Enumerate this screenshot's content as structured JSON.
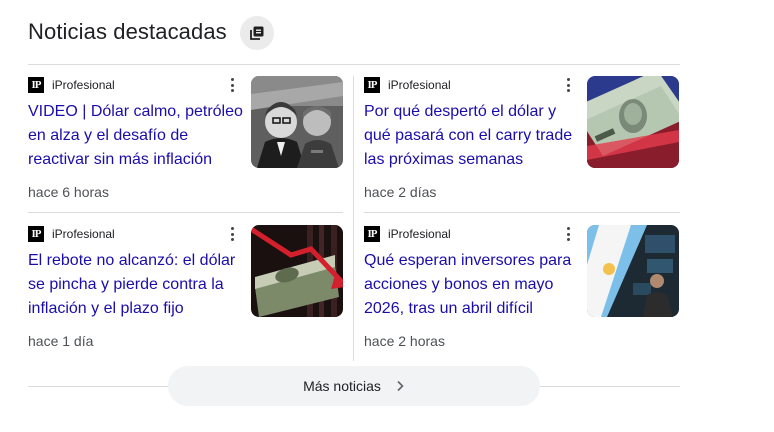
{
  "section": {
    "title": "Noticias destacadas"
  },
  "articles": [
    {
      "source": "iProfesional",
      "logo_text": "IP",
      "headline": "VIDEO | Dólar calmo, petróleo en alza y el desafío de reactivar sin más inflación",
      "time": "hace 6 horas",
      "thumbnail": "grayscale-portraits-on-dollar-bill"
    },
    {
      "source": "iProfesional",
      "logo_text": "IP",
      "headline": "Por qué despertó el dólar y qué pasará con el carry trade las próximas semanas",
      "time": "hace 2 días",
      "thumbnail": "dollar-bills-red-blue-light"
    },
    {
      "source": "iProfesional",
      "logo_text": "IP",
      "headline": "El rebote no alcanzó: el dólar se pincha y pierde contra la inflación y el plazo fijo",
      "time": "hace 1 día",
      "thumbnail": "dollar-stack-red-arrow"
    },
    {
      "source": "iProfesional",
      "logo_text": "IP",
      "headline": "Qué esperan inversores para acciones y bonos en mayo 2026, tras un abril difícil",
      "time": "hace 2 horas",
      "thumbnail": "argentina-flag-stock-trader"
    }
  ],
  "more_button": {
    "label": "Más noticias"
  },
  "colors": {
    "link": "#1a0dab",
    "meta": "#4d5156",
    "divider": "#dadce0",
    "button_bg": "#f1f3f4"
  }
}
